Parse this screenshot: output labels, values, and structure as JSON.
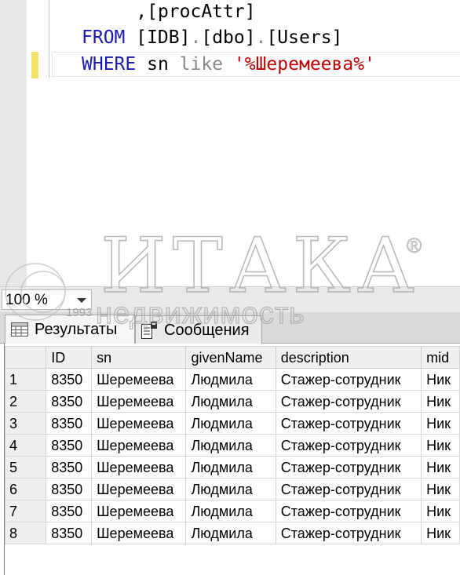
{
  "editor": {
    "lines": [
      {
        "indent": "     ",
        "seg1": ",[procAttr]"
      },
      {
        "kw1": "FROM",
        "seg1": " [IDB]",
        "dot1": ".",
        "seg2": "[dbo]",
        "dot2": ".",
        "seg3": "[Users]"
      },
      {
        "kw1": "WHERE",
        "seg1": " sn ",
        "op": "like",
        "sp": " ",
        "str": "'%Шеремеева%'"
      }
    ]
  },
  "colors": {
    "keyword": "#1a1ab0",
    "string": "#c00000",
    "operator": "#888888",
    "change_marker": "#f4e26e"
  },
  "zoom": {
    "value": "100 %",
    "icon": "chevron-down-icon"
  },
  "watermark": {
    "brand": "ИТАКА",
    "registered": "®",
    "year": "1993",
    "tagline": "недвижимость"
  },
  "tabs": [
    {
      "label": "Результаты",
      "icon": "grid-icon",
      "active": true
    },
    {
      "label": "Сообщения",
      "icon": "messages-icon",
      "active": false
    }
  ],
  "grid": {
    "columns": [
      "",
      "ID",
      "sn",
      "givenName",
      "description",
      "mid"
    ],
    "rows": [
      [
        "1",
        "8350",
        "Шеремеева",
        "Людмила",
        "Стажер-сотрудник",
        "Ник"
      ],
      [
        "2",
        "8350",
        "Шеремеева",
        "Людмила",
        "Стажер-сотрудник",
        "Ник"
      ],
      [
        "3",
        "8350",
        "Шеремеева",
        "Людмила",
        "Стажер-сотрудник",
        "Ник"
      ],
      [
        "4",
        "8350",
        "Шеремеева",
        "Людмила",
        "Стажер-сотрудник",
        "Ник"
      ],
      [
        "5",
        "8350",
        "Шеремеева",
        "Людмила",
        "Стажер-сотрудник",
        "Ник"
      ],
      [
        "6",
        "8350",
        "Шеремеева",
        "Людмила",
        "Стажер-сотрудник",
        "Ник"
      ],
      [
        "7",
        "8350",
        "Шеремеева",
        "Людмила",
        "Стажер-сотрудник",
        "Ник"
      ],
      [
        "8",
        "8350",
        "Шеремеева",
        "Людмила",
        "Стажер-сотрудник",
        "Ник"
      ]
    ]
  }
}
